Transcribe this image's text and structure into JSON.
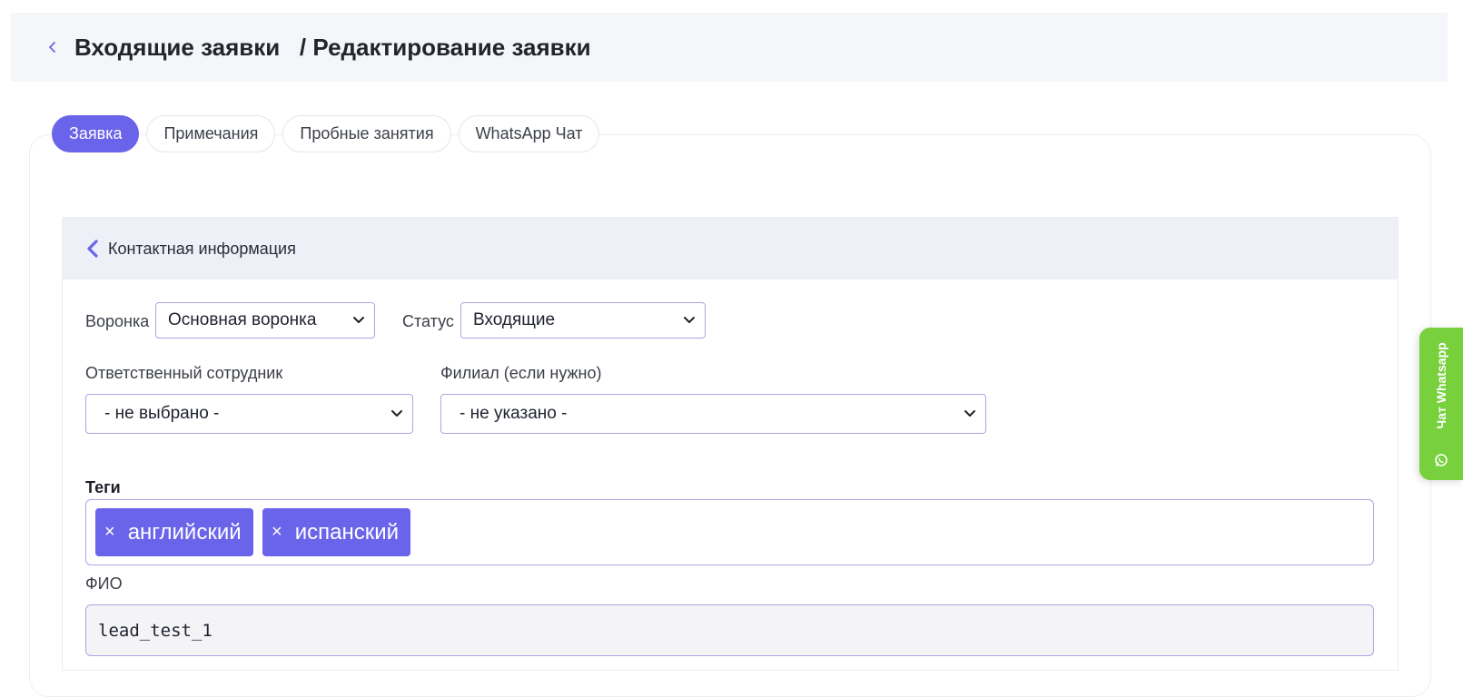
{
  "header": {
    "title": "Входящие заявки   / Редактирование заявки"
  },
  "tabs": [
    {
      "label": "Заявка",
      "active": true
    },
    {
      "label": "Примечания",
      "active": false
    },
    {
      "label": "Пробные занятия",
      "active": false
    },
    {
      "label": "WhatsApp Чат",
      "active": false
    }
  ],
  "section": {
    "title": "Контактная информация"
  },
  "form": {
    "funnel_label": "Воронка",
    "funnel_value": "Основная воронка",
    "status_label": "Статус",
    "status_value": "Входящие",
    "employee_label": "Ответственный сотрудник",
    "employee_value": "- не выбрано -",
    "branch_label": "Филиал (если нужно)",
    "branch_value": "- не указано -",
    "tags_label": "Теги",
    "tags": [
      "английский",
      "испанский"
    ],
    "tag_remove_symbol": "×",
    "fio_label": "ФИО",
    "fio_value": "lead_test_1"
  },
  "side_widget": {
    "label": "Чат Whatsapp",
    "icon": "whatsapp-icon"
  },
  "colors": {
    "accent": "#6a64ea",
    "whatsapp_green": "#77d03c",
    "header_bg": "#f5f6f9",
    "section_head_bg": "#eef0f8"
  }
}
